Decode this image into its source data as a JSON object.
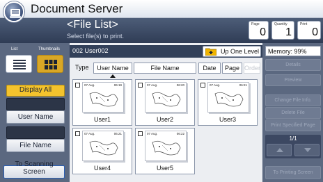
{
  "app": {
    "title": "Document Server"
  },
  "header": {
    "title": "<File List>",
    "subtitle": "Select file(s) to print."
  },
  "counters": {
    "page": {
      "label": "Page",
      "value": "0"
    },
    "quantity": {
      "label": "Quantity",
      "value": "1"
    },
    "print": {
      "label": "Print",
      "value": "0"
    }
  },
  "view_tabs": {
    "list_label": "List",
    "thumbnails_label": "Thumbnails",
    "active": "thumbnails"
  },
  "left_buttons": {
    "display_all": "Display All",
    "user_name": "User Name",
    "file_name": "File Name",
    "to_scanning": "To Scanning Screen"
  },
  "path": {
    "current": "002 User002",
    "up_label": "Up One Level"
  },
  "sort": {
    "type_label": "Type",
    "columns": [
      "User Name",
      "File Name",
      "Date",
      "Page",
      "Order"
    ]
  },
  "files": [
    {
      "date": "07 Aug.",
      "time": "06:19",
      "user": "User1"
    },
    {
      "date": "07 Aug.",
      "time": "06:20",
      "user": "User2"
    },
    {
      "date": "07 Aug.",
      "time": "06:21",
      "user": "User3"
    },
    {
      "date": "07 Aug.",
      "time": "06:21",
      "user": "User4"
    },
    {
      "date": "07 Aug.",
      "time": "06:22",
      "user": "User5"
    }
  ],
  "right": {
    "memory": "Memory:  99%",
    "details": "Details",
    "preview": "Preview",
    "change_file_info": "Change File Info.",
    "delete_file": "Delete File",
    "print_specified_page": "Print Specified Page",
    "page_indicator": "1/1",
    "to_printing": "To Printing Screen"
  },
  "colors": {
    "accent": "#f4c32d",
    "header_bg": "#3b4a66",
    "panel_bg": "#5b6880"
  }
}
